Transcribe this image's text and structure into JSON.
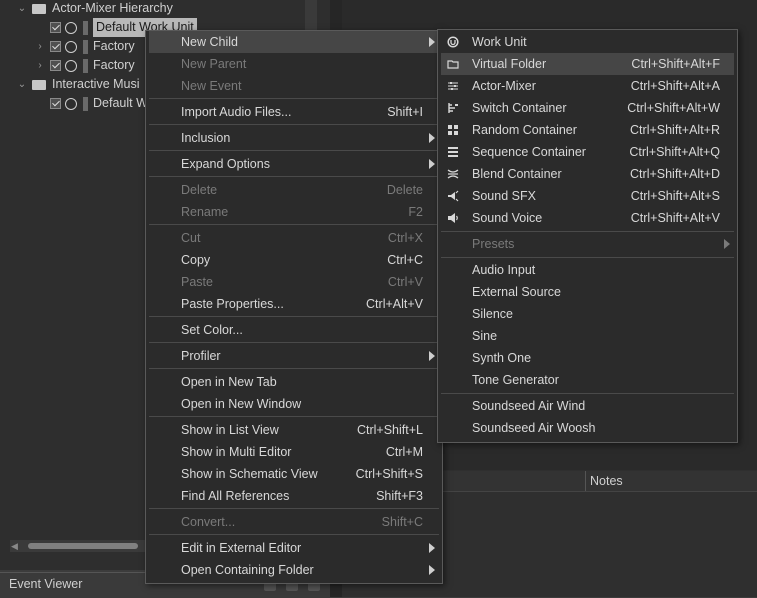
{
  "tree": {
    "rows": [
      {
        "label": "Actor-Mixer Hierarchy"
      },
      {
        "label": "Default Work Unit"
      },
      {
        "label": "Factory"
      },
      {
        "label": "Factory"
      },
      {
        "label": "Interactive Musi"
      },
      {
        "label": "Default W"
      }
    ]
  },
  "list_header": {
    "notes": "Notes"
  },
  "bottom_panel": {
    "event_viewer": "Event Viewer"
  },
  "context_menu": {
    "items": [
      {
        "label": "New Child",
        "shortcut": ""
      },
      {
        "label": "New Parent",
        "shortcut": ""
      },
      {
        "label": "New Event",
        "shortcut": ""
      },
      {
        "label": "Import Audio Files...",
        "shortcut": "Shift+I"
      },
      {
        "label": "Inclusion",
        "shortcut": ""
      },
      {
        "label": "Expand Options",
        "shortcut": ""
      },
      {
        "label": "Delete",
        "shortcut": "Delete"
      },
      {
        "label": "Rename",
        "shortcut": "F2"
      },
      {
        "label": "Cut",
        "shortcut": "Ctrl+X"
      },
      {
        "label": "Copy",
        "shortcut": "Ctrl+C"
      },
      {
        "label": "Paste",
        "shortcut": "Ctrl+V"
      },
      {
        "label": "Paste Properties...",
        "shortcut": "Ctrl+Alt+V"
      },
      {
        "label": "Set Color...",
        "shortcut": ""
      },
      {
        "label": "Profiler",
        "shortcut": ""
      },
      {
        "label": "Open in New Tab",
        "shortcut": ""
      },
      {
        "label": "Open in New Window",
        "shortcut": ""
      },
      {
        "label": "Show in List View",
        "shortcut": "Ctrl+Shift+L"
      },
      {
        "label": "Show in Multi Editor",
        "shortcut": "Ctrl+M"
      },
      {
        "label": "Show in Schematic View",
        "shortcut": "Ctrl+Shift+S"
      },
      {
        "label": "Find All References",
        "shortcut": "Shift+F3"
      },
      {
        "label": "Convert...",
        "shortcut": "Shift+C"
      },
      {
        "label": "Edit in External Editor",
        "shortcut": ""
      },
      {
        "label": "Open Containing Folder",
        "shortcut": ""
      }
    ]
  },
  "submenu": {
    "items": [
      {
        "label": "Work Unit",
        "shortcut": "",
        "icon": "work-unit-icon"
      },
      {
        "label": "Virtual Folder",
        "shortcut": "Ctrl+Shift+Alt+F",
        "icon": "folder-icon"
      },
      {
        "label": "Actor-Mixer",
        "shortcut": "Ctrl+Shift+Alt+A",
        "icon": "actor-mixer-icon"
      },
      {
        "label": "Switch Container",
        "shortcut": "Ctrl+Shift+Alt+W",
        "icon": "switch-container-icon"
      },
      {
        "label": "Random Container",
        "shortcut": "Ctrl+Shift+Alt+R",
        "icon": "random-container-icon"
      },
      {
        "label": "Sequence Container",
        "shortcut": "Ctrl+Shift+Alt+Q",
        "icon": "sequence-container-icon"
      },
      {
        "label": "Blend Container",
        "shortcut": "Ctrl+Shift+Alt+D",
        "icon": "blend-container-icon"
      },
      {
        "label": "Sound SFX",
        "shortcut": "Ctrl+Shift+Alt+S",
        "icon": "sound-sfx-icon"
      },
      {
        "label": "Sound Voice",
        "shortcut": "Ctrl+Shift+Alt+V",
        "icon": "sound-voice-icon"
      },
      {
        "label": "Presets",
        "shortcut": ""
      },
      {
        "label": "Audio Input",
        "shortcut": ""
      },
      {
        "label": "External Source",
        "shortcut": ""
      },
      {
        "label": "Silence",
        "shortcut": ""
      },
      {
        "label": "Sine",
        "shortcut": ""
      },
      {
        "label": "Synth One",
        "shortcut": ""
      },
      {
        "label": "Tone Generator",
        "shortcut": ""
      },
      {
        "label": "Soundseed Air Wind",
        "shortcut": ""
      },
      {
        "label": "Soundseed Air Woosh",
        "shortcut": ""
      }
    ]
  }
}
